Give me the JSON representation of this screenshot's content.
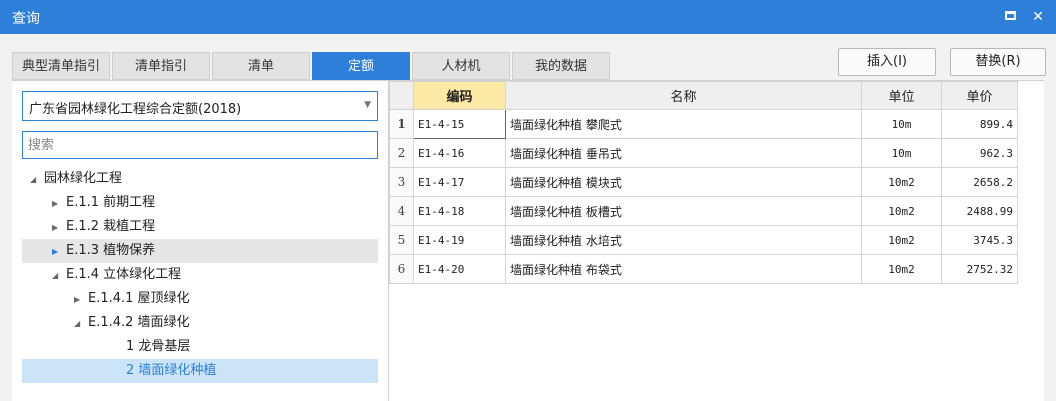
{
  "window": {
    "title": "查询"
  },
  "tabs": [
    {
      "label": "典型清单指引",
      "active": false
    },
    {
      "label": "清单指引",
      "active": false
    },
    {
      "label": "清单",
      "active": false
    },
    {
      "label": "定额",
      "active": true
    },
    {
      "label": "人材机",
      "active": false
    },
    {
      "label": "我的数据",
      "active": false
    }
  ],
  "actions": {
    "insert_label": "插入(I)",
    "replace_label": "替换(R)"
  },
  "left": {
    "quota_library": "广东省园林绿化工程综合定额(2018)",
    "search_placeholder": "搜索",
    "tree": [
      {
        "label": "园林绿化工程",
        "toggle": "expanded"
      },
      {
        "label": "E.1.1 前期工程",
        "toggle": "collapsed"
      },
      {
        "label": "E.1.2 栽植工程",
        "toggle": "collapsed"
      },
      {
        "label": "E.1.3 植物保养",
        "toggle": "collapsed"
      },
      {
        "label": "E.1.4 立体绿化工程",
        "toggle": "expanded"
      },
      {
        "label": "E.1.4.1 屋顶绿化",
        "toggle": "collapsed"
      },
      {
        "label": "E.1.4.2 墙面绿化",
        "toggle": "expanded"
      },
      {
        "label": "1 龙骨基层",
        "toggle": "none"
      },
      {
        "label": "2 墙面绿化种植",
        "toggle": "none"
      }
    ]
  },
  "grid": {
    "headers": {
      "code": "编码",
      "name": "名称",
      "unit": "单位",
      "price": "单价"
    },
    "rows": [
      {
        "no": "1",
        "code": "E1-4-15",
        "name": "墙面绿化种植 攀爬式",
        "unit": "10m",
        "price": "899.4"
      },
      {
        "no": "2",
        "code": "E1-4-16",
        "name": "墙面绿化种植 垂吊式",
        "unit": "10m",
        "price": "962.3"
      },
      {
        "no": "3",
        "code": "E1-4-17",
        "name": "墙面绿化种植 模块式",
        "unit": "10m2",
        "price": "2658.2"
      },
      {
        "no": "4",
        "code": "E1-4-18",
        "name": "墙面绿化种植 板槽式",
        "unit": "10m2",
        "price": "2488.99"
      },
      {
        "no": "5",
        "code": "E1-4-19",
        "name": "墙面绿化种植 水培式",
        "unit": "10m2",
        "price": "3745.3"
      },
      {
        "no": "6",
        "code": "E1-4-20",
        "name": "墙面绿化种植 布袋式",
        "unit": "10m2",
        "price": "2752.32"
      }
    ]
  },
  "colors": {
    "accent": "#2e7fd9",
    "header_sorted": "#fde9a6",
    "selected_node": "#cce4f7"
  }
}
